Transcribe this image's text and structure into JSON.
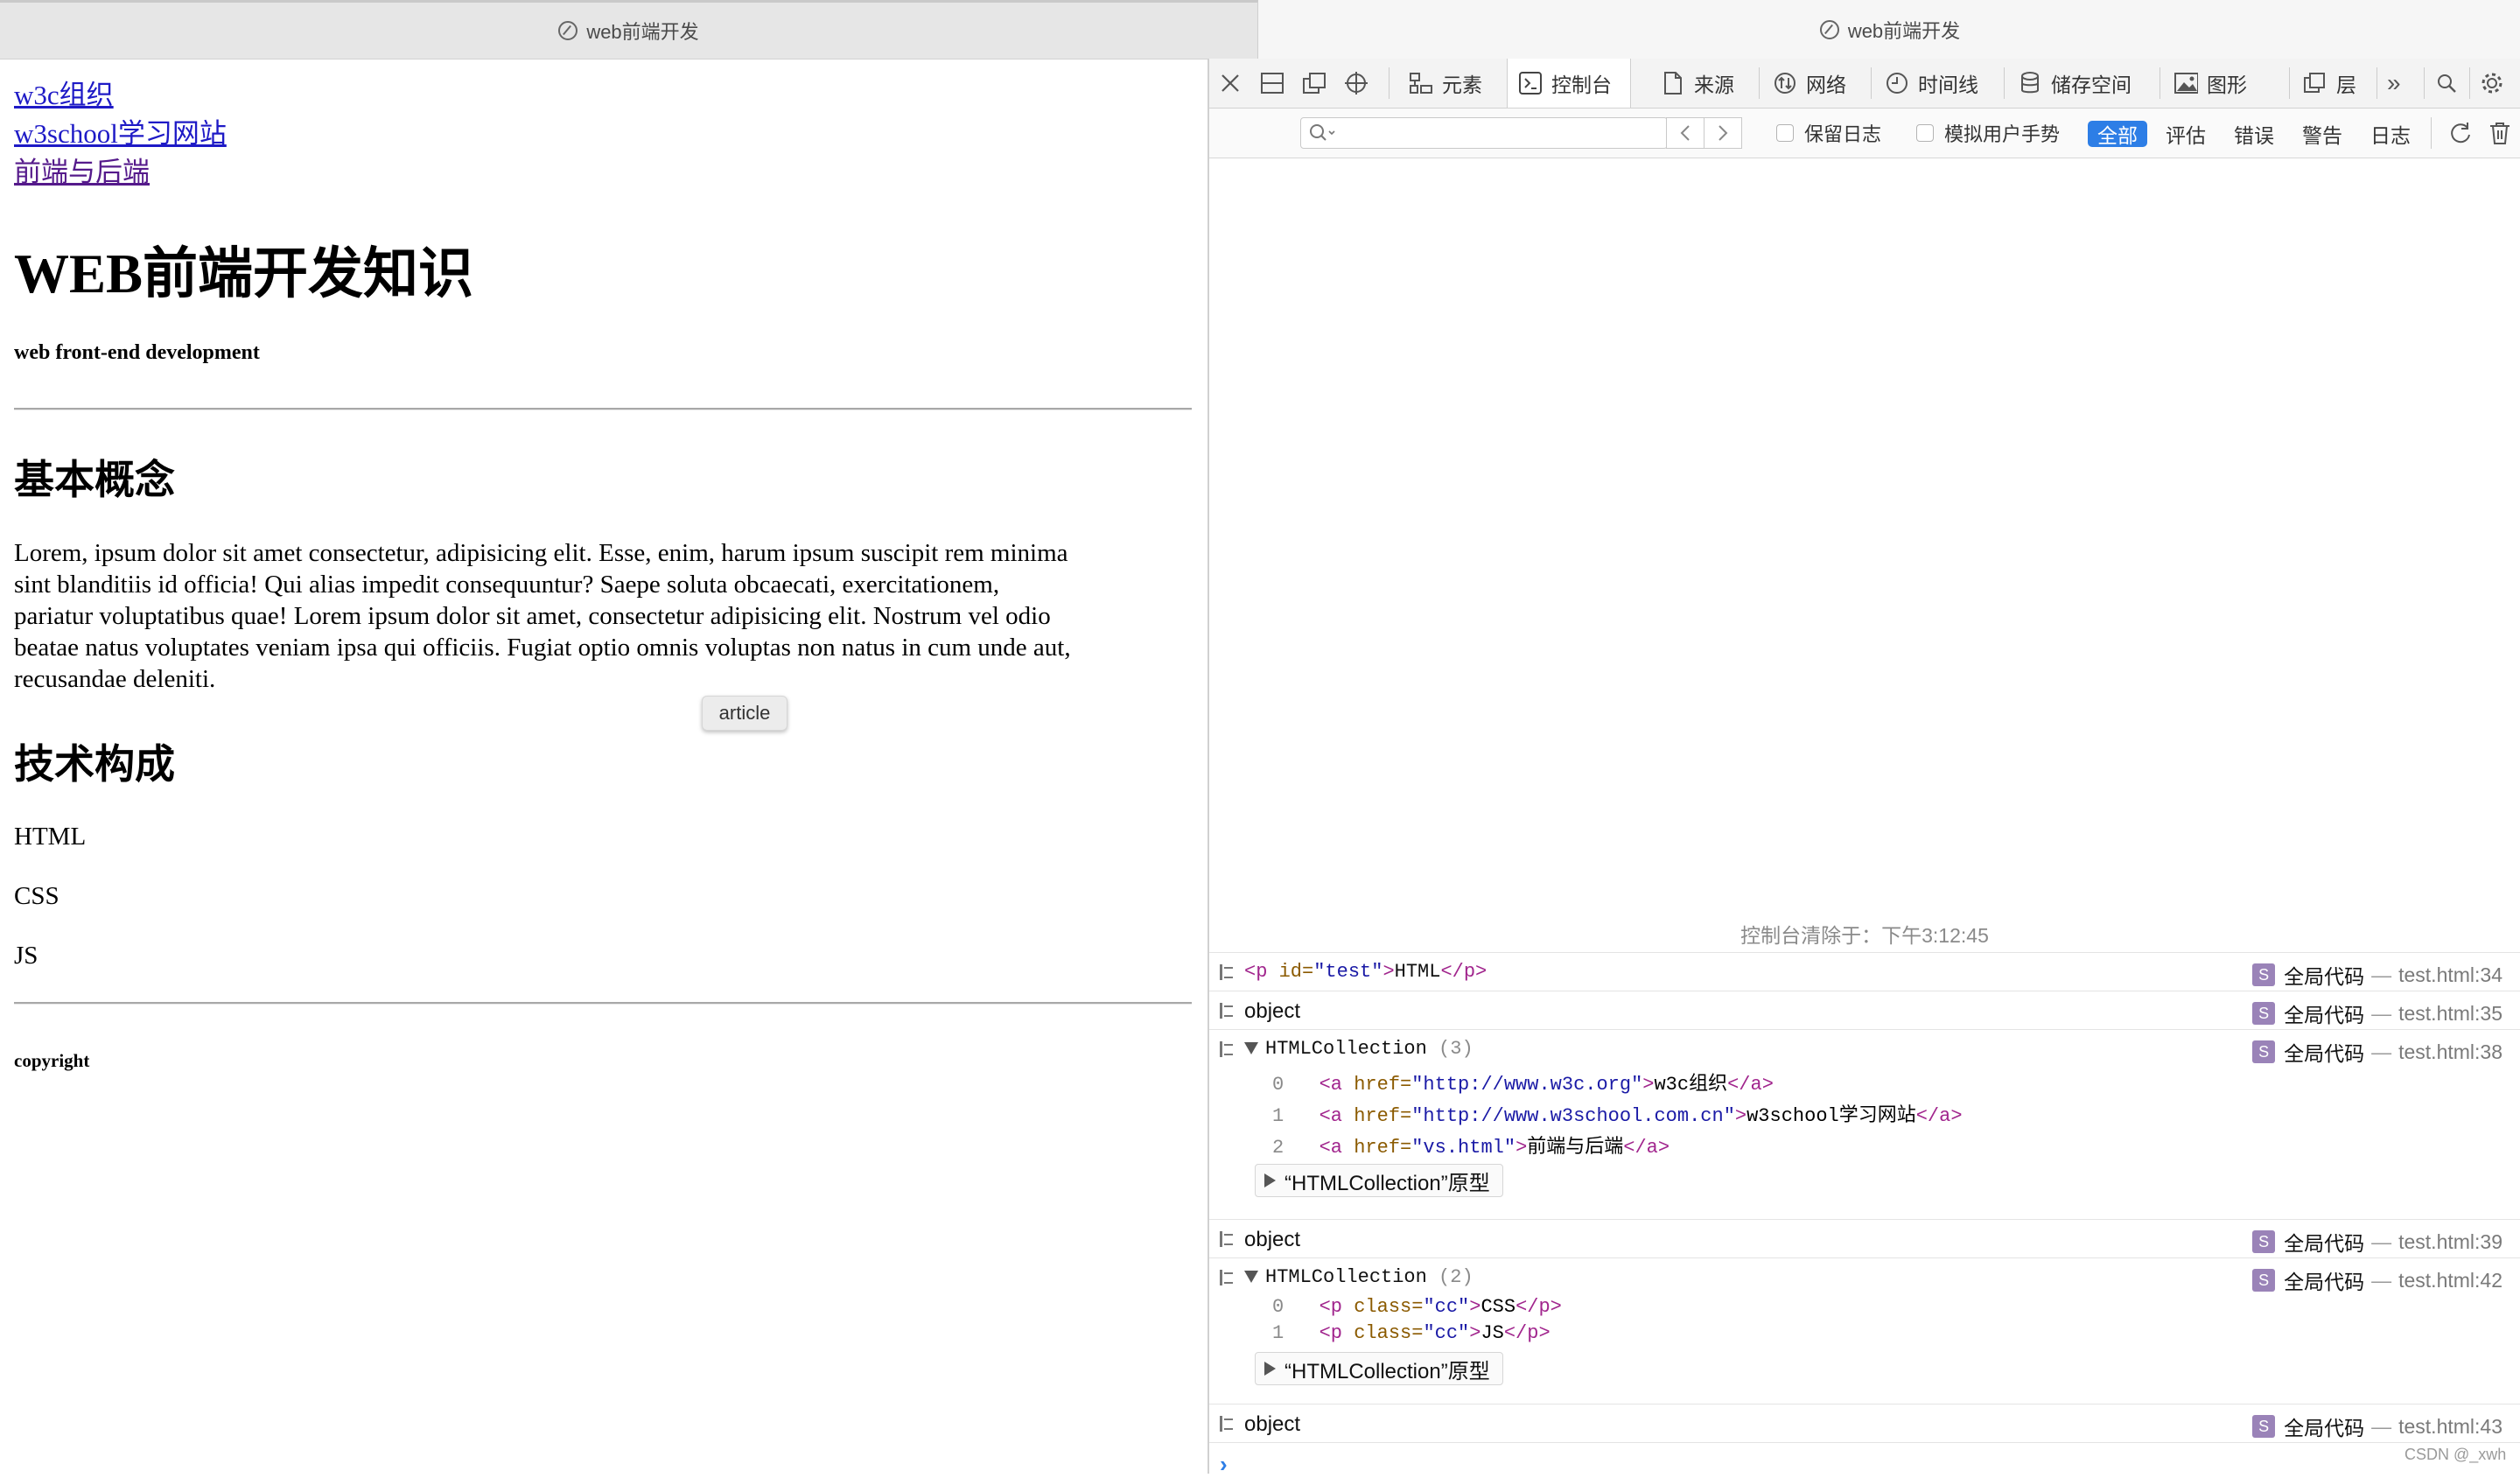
{
  "tabs": {
    "left_title": "web前端开发",
    "right_title": "web前端开发"
  },
  "page": {
    "links": [
      "w3c组织",
      "w3school学习网站",
      "前端与后端"
    ],
    "h1": "WEB前端开发知识",
    "subtitle": "web front-end development",
    "section1_title": "基本概念",
    "paragraph_lines": [
      "Lorem, ipsum dolor sit amet consectetur, adipisicing elit. Esse, enim, harum ipsum suscipit rem minima",
      "sint blanditiis id officia! Qui alias impedit consequuntur? Saepe soluta obcaecati, exercitationem,",
      "pariatur voluptatibus quae! Lorem ipsum dolor sit amet, consectetur adipisicing elit. Nostrum vel odio",
      "beatae natus voluptates veniam ipsa qui officiis. Fugiat optio omnis voluptas non natus in cum unde aut,",
      "recusandae deleniti."
    ],
    "tooltip": "article",
    "section2_title": "技术构成",
    "tech": [
      "HTML",
      "CSS",
      "JS"
    ],
    "copyright": "copyright"
  },
  "devtools": {
    "tabs": [
      "元素",
      "控制台",
      "来源",
      "网络",
      "时间线",
      "储存空间",
      "图形",
      "层"
    ],
    "selected_tab": "控制台",
    "checkboxes": [
      "保留日志",
      "模拟用户手势"
    ],
    "filters": [
      "全部",
      "评估",
      "错误",
      "警告",
      "日志"
    ],
    "active_filter": "全部",
    "cleared_text": "控制台清除于：下午3:12:45",
    "source_label": "全局代码",
    "source_badge": "S",
    "messages": {
      "m1": {
        "tag_open": "<p",
        "attr": " id=",
        "val": "\"test\"",
        "close": ">",
        "text": "HTML",
        "tag_close": "</p>",
        "file": "test.html:34"
      },
      "m2": {
        "text": "object",
        "file": "test.html:35"
      },
      "m3": {
        "label": "HTMLCollection",
        "count": "(3)",
        "file": "test.html:38",
        "items": [
          {
            "index": "0",
            "href": "\"http://www.w3c.org\"",
            "text": "w3c组织"
          },
          {
            "index": "1",
            "href": "\"http://www.w3school.com.cn\"",
            "text": "w3school学习网站"
          },
          {
            "index": "2",
            "href": "\"vs.html\"",
            "text": "前端与后端"
          }
        ],
        "proto": "“HTMLCollection”原型"
      },
      "m4": {
        "text": "object",
        "file": "test.html:39"
      },
      "m5": {
        "label": "HTMLCollection",
        "count": "(2)",
        "file": "test.html:42",
        "items": [
          {
            "index": "0",
            "cls": "\"cc\"",
            "text": "CSS"
          },
          {
            "index": "1",
            "cls": "\"cc\"",
            "text": "JS"
          }
        ],
        "proto": "“HTMLCollection”原型"
      },
      "m6": {
        "text": "object",
        "file": "test.html:43"
      }
    },
    "prompt": "›"
  },
  "watermark": "CSDN @_xwh",
  "colors": {
    "link": "#1e1ac6",
    "visited": "#551a8b",
    "active_filter_bg": "#2d7ee6",
    "source_badge_bg": "#9a83b8",
    "tag": "#a1258d",
    "attr": "#8b5a00",
    "value": "#1a1aa6"
  }
}
